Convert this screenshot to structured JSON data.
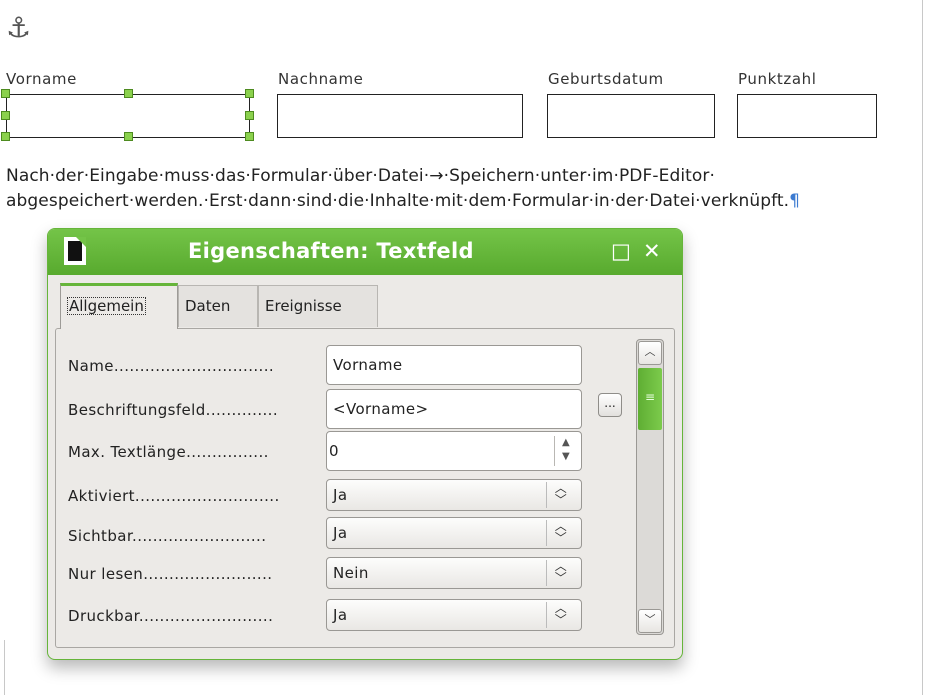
{
  "icons": {
    "anchor": "anchor-icon"
  },
  "form": {
    "labels": [
      "Vorname",
      "Nachname",
      "Geburtsdatum",
      "Punktzahl"
    ]
  },
  "paragraph": {
    "line1": "Nach·der·Eingabe·muss·das·Formular·über·Datei·→·Speichern·unter·im·PDF-Editor·",
    "line2": "abgespeichert·werden.·Erst·dann·sind·die·Inhalte·mit·dem·Formular·in·der·Datei·verknüpft.",
    "pilcrow": "¶"
  },
  "dialog": {
    "title": "Eigenschaften: Textfeld",
    "maximize": "□",
    "close": "✕",
    "tabs": [
      "Allgemein",
      "Daten",
      "Ereignisse"
    ],
    "rows": [
      {
        "label": "Name...............................",
        "value": "Vorname"
      },
      {
        "label": "Beschriftungsfeld..............",
        "value": "<Vorname>"
      },
      {
        "label": "Max. Textlänge................",
        "value": "0"
      },
      {
        "label": "Aktiviert............................",
        "value": "Ja"
      },
      {
        "label": "Sichtbar..........................",
        "value": "Ja"
      },
      {
        "label": "Nur lesen.........................",
        "value": "Nein"
      },
      {
        "label": "Druckbar..........................",
        "value": "Ja"
      }
    ],
    "dots_button": "...",
    "accent_color": "#66b53a"
  }
}
